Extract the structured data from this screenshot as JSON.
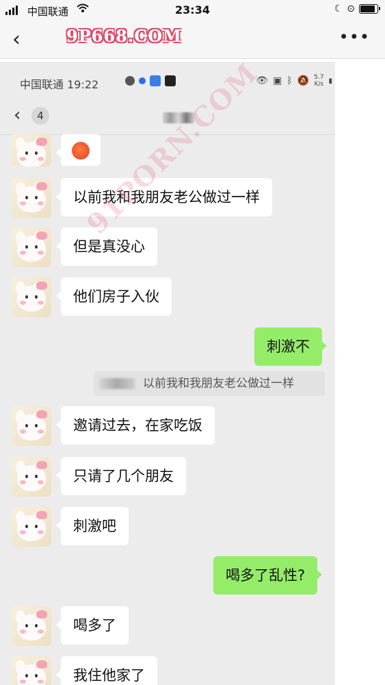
{
  "statusbar": {
    "carrier": "中国联通",
    "time": "23:34"
  },
  "navbar": {
    "back_glyph": "‹",
    "brand": "9P668.COM",
    "more_glyph": "•••"
  },
  "inner": {
    "status_text": "中国联通 19:22",
    "net_speed_value": "5.7",
    "net_speed_unit": "K/s",
    "unread_count": "4"
  },
  "messages": [
    {
      "side": "left",
      "text": "",
      "emoji": "red-face-emoji"
    },
    {
      "side": "left",
      "text": "以前我和我朋友老公做过一样"
    },
    {
      "side": "left",
      "text": "但是真没心"
    },
    {
      "side": "left",
      "text": "他们房子入伙"
    },
    {
      "side": "right",
      "text": "刺激不"
    },
    {
      "side": "left",
      "text": "邀请过去，在家吃饭"
    },
    {
      "side": "left",
      "text": "只请了几个朋友"
    },
    {
      "side": "left",
      "text": "刺激吧"
    },
    {
      "side": "right",
      "text": "喝多了乱性?"
    },
    {
      "side": "left",
      "text": "喝多了"
    },
    {
      "side": "left",
      "text": "我住他家了"
    }
  ],
  "quote": {
    "text": "以前我和我朋友老公做过一样"
  },
  "watermark": "91PORN.COM",
  "colors": {
    "my_bubble": "#95ec69",
    "their_bubble": "#ffffff",
    "chat_bg": "#ececec",
    "brand_outline": "#d94e6a"
  }
}
